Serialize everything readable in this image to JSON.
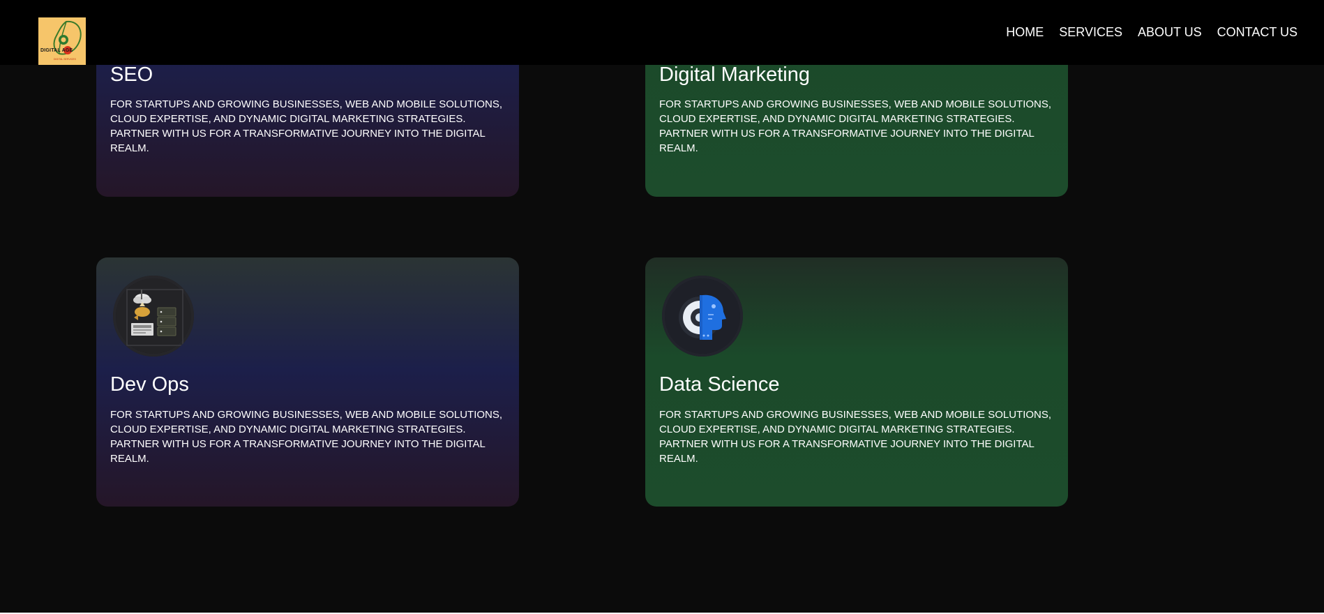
{
  "brand": {
    "logo_text": "DIGITAL AGE",
    "logo_subtext": "DIGITAL SERVICES",
    "logo_color": "#f6c56a"
  },
  "nav": {
    "home": "HOME",
    "services": "SERVICES",
    "about": "ABOUT US",
    "contact": "CONTACT US"
  },
  "services": [
    {
      "title": "SEO",
      "description": "FOR STARTUPS AND GROWING BUSINESSES, WEB AND MOBILE SOLUTIONS, CLOUD EXPERTISE, AND DYNAMIC DIGITAL MARKETING STRATEGIES. PARTNER WITH US FOR A TRANSFORMATIVE JOURNEY INTO THE DIGITAL REALM.",
      "theme_color": "#1c1f4a"
    },
    {
      "title": "Digital Marketing",
      "description": "FOR STARTUPS AND GROWING BUSINESSES, WEB AND MOBILE SOLUTIONS, CLOUD EXPERTISE, AND DYNAMIC DIGITAL MARKETING STRATEGIES. PARTNER WITH US FOR A TRANSFORMATIVE JOURNEY INTO THE DIGITAL REALM.",
      "theme_color": "#1b4a2a"
    },
    {
      "title": "Dev Ops",
      "description": "FOR STARTUPS AND GROWING BUSINESSES, WEB AND MOBILE SOLUTIONS, CLOUD EXPERTISE, AND DYNAMIC DIGITAL MARKETING STRATEGIES. PARTNER WITH US FOR A TRANSFORMATIVE JOURNEY INTO THE DIGITAL REALM.",
      "icon": "cloud-server-icon",
      "theme_color": "#1c1f4a"
    },
    {
      "title": "Data Science",
      "description": "FOR STARTUPS AND GROWING BUSINESSES, WEB AND MOBILE SOLUTIONS, CLOUD EXPERTISE, AND DYNAMIC DIGITAL MARKETING STRATEGIES. PARTNER WITH US FOR A TRANSFORMATIVE JOURNEY INTO THE DIGITAL REALM.",
      "icon": "ai-head-gear-icon",
      "theme_color": "#1b4a2a"
    }
  ]
}
